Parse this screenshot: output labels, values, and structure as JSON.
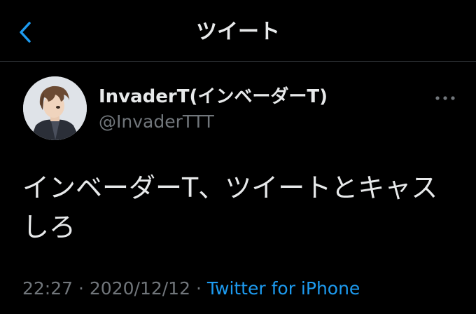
{
  "header": {
    "title": "ツイート",
    "back_icon": "chevron-left-icon"
  },
  "tweet": {
    "display_name": "InvaderT(インベーダーT)",
    "handle": "@InvaderTTT",
    "text": "インベーダーT、ツイートとキャスしろ",
    "time": "22:27",
    "separator": "·",
    "date": "2020/12/12",
    "source": "Twitter for iPhone",
    "more_icon": "more-horizontal-icon"
  },
  "colors": {
    "background": "#000000",
    "text": "#e7e9ea",
    "muted": "#71767b",
    "accent": "#1d9bf0",
    "divider": "#2f3336"
  }
}
